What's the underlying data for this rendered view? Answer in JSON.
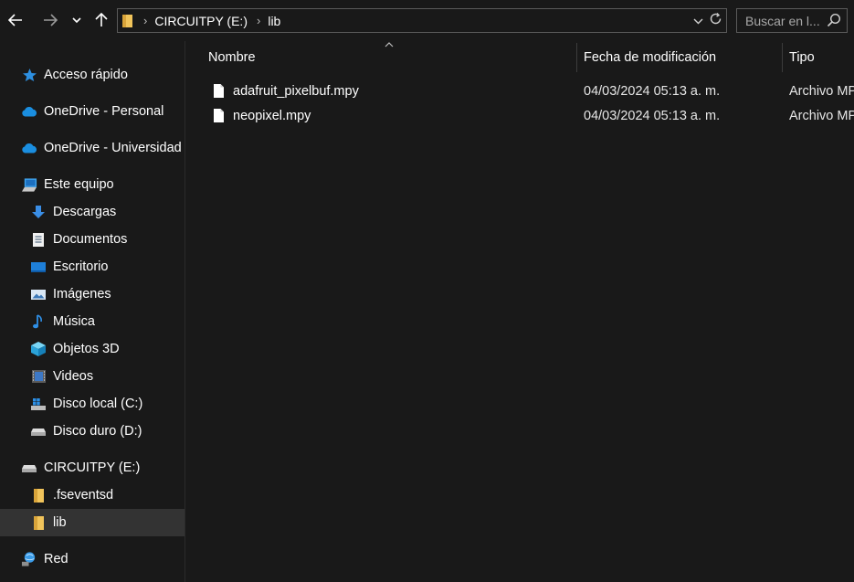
{
  "navigation": {
    "back_icon": "arrow-left-icon",
    "forward_icon": "arrow-right-icon",
    "recent_icon": "chevron-down-icon",
    "up_icon": "arrow-up-icon"
  },
  "address_bar": {
    "breadcrumbs": [
      "CIRCUITPY (E:)",
      "lib"
    ],
    "separator": "›"
  },
  "search": {
    "placeholder": "Buscar en l..."
  },
  "sidebar": {
    "items": [
      {
        "label": "Acceso rápido",
        "icon": "star-icon",
        "level": 0
      },
      {
        "label": "OneDrive - Personal",
        "icon": "cloud-icon",
        "level": 0
      },
      {
        "label": "OneDrive - Universidad",
        "icon": "cloud-icon",
        "level": 0
      },
      {
        "label": "Este equipo",
        "icon": "computer-icon",
        "level": 0
      },
      {
        "label": "Descargas",
        "icon": "download-icon",
        "level": 1
      },
      {
        "label": "Documentos",
        "icon": "document-icon",
        "level": 1
      },
      {
        "label": "Escritorio",
        "icon": "desktop-icon",
        "level": 1
      },
      {
        "label": "Imágenes",
        "icon": "pictures-icon",
        "level": 1
      },
      {
        "label": "Música",
        "icon": "music-icon",
        "level": 1
      },
      {
        "label": "Objetos 3D",
        "icon": "cube-icon",
        "level": 1
      },
      {
        "label": "Videos",
        "icon": "video-icon",
        "level": 1
      },
      {
        "label": "Disco local (C:)",
        "icon": "windows-drive-icon",
        "level": 1
      },
      {
        "label": "Disco duro (D:)",
        "icon": "drive-icon",
        "level": 1
      },
      {
        "label": "CIRCUITPY (E:)",
        "icon": "drive-icon",
        "level": 0
      },
      {
        "label": ".fseventsd",
        "icon": "folder-icon",
        "level": 1
      },
      {
        "label": "lib",
        "icon": "folder-icon",
        "level": 1,
        "selected": true
      },
      {
        "label": "Red",
        "icon": "network-icon",
        "level": 0
      }
    ]
  },
  "columns": {
    "name": "Nombre",
    "modified": "Fecha de modificación",
    "type": "Tipo"
  },
  "files": [
    {
      "name": "adafruit_pixelbuf.mpy",
      "modified": "04/03/2024 05:13 a. m.",
      "type": "Archivo MPY"
    },
    {
      "name": "neopixel.mpy",
      "modified": "04/03/2024 05:13 a. m.",
      "type": "Archivo MPY"
    }
  ],
  "colors": {
    "background": "#191919",
    "selected": "#333333",
    "folder": "#f1c45b",
    "onedrive": "#1a8ee0",
    "text": "#ffffff"
  }
}
